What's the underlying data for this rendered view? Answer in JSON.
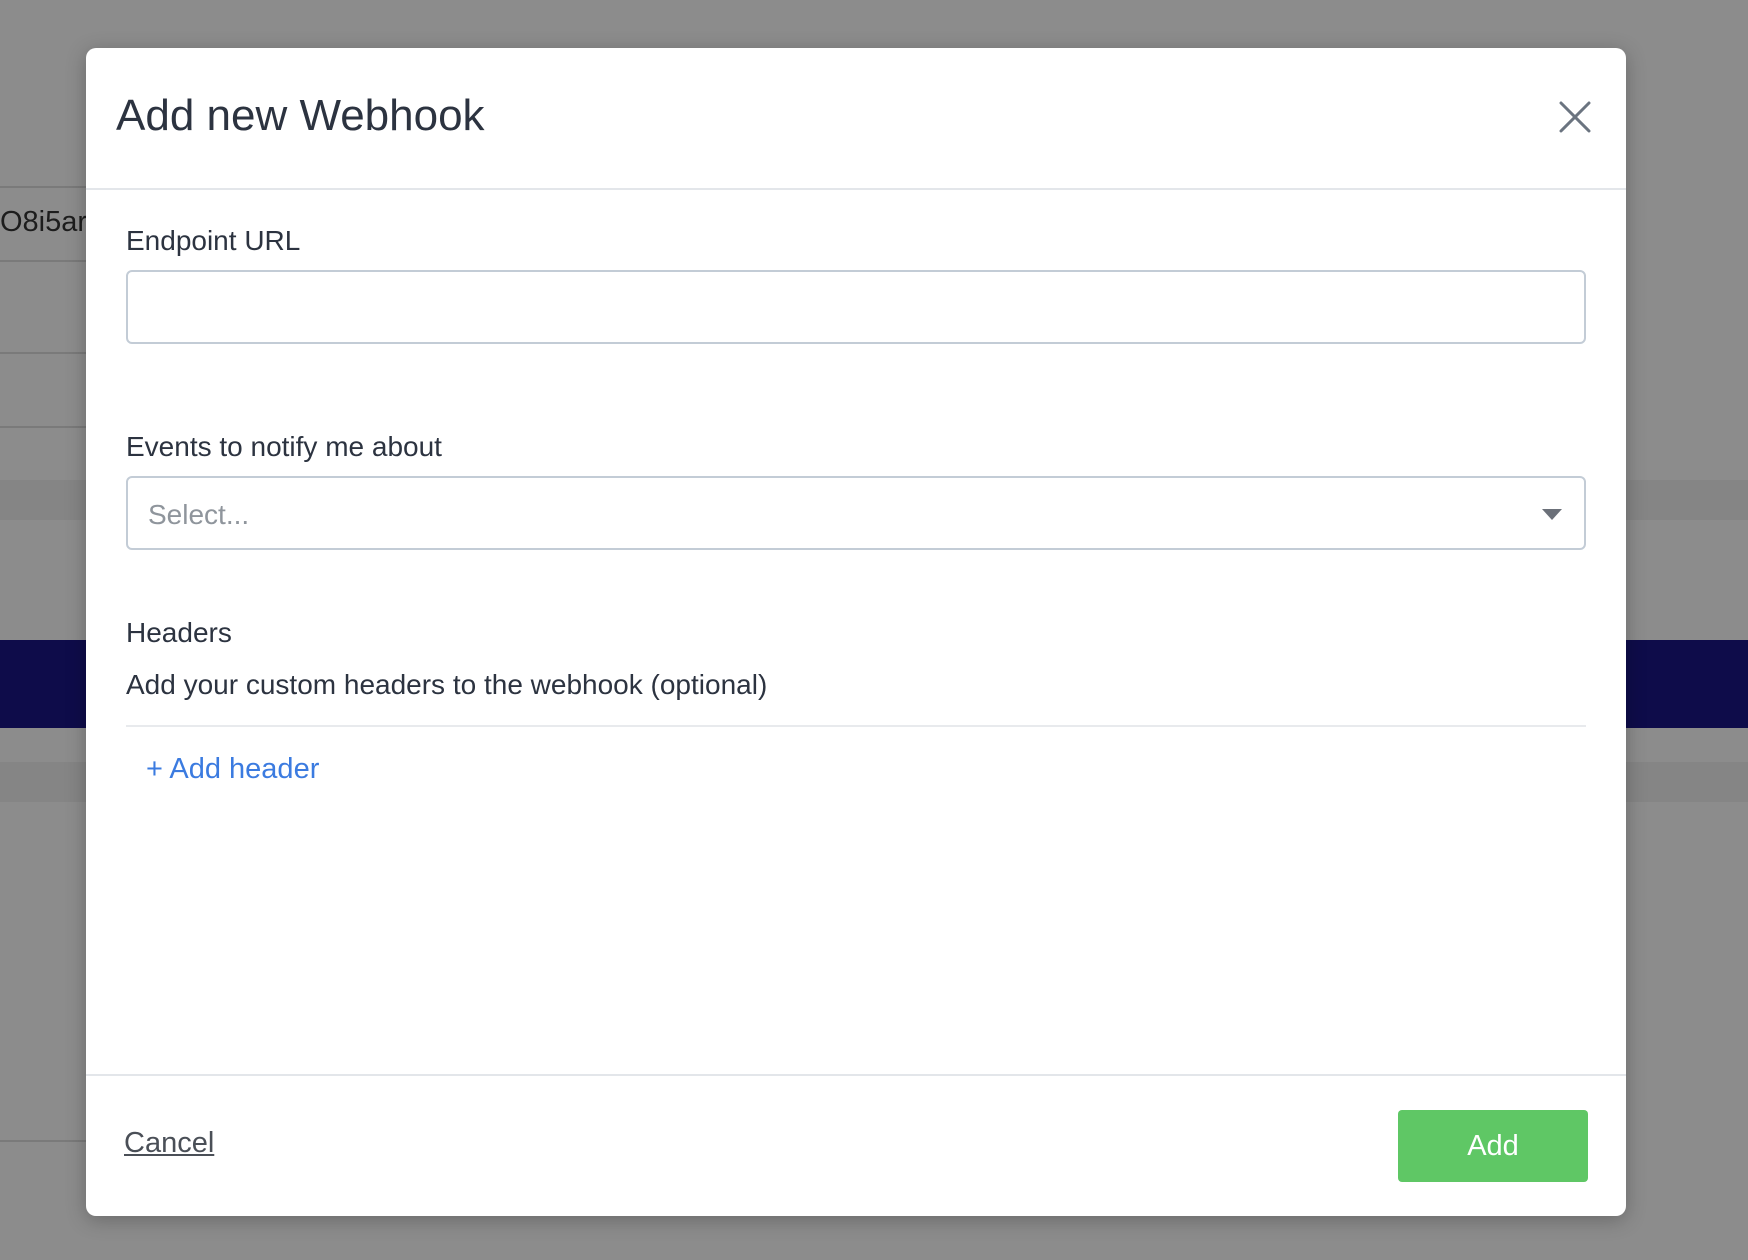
{
  "background": {
    "partial_text": "O8i5ar"
  },
  "modal": {
    "title": "Add new Webhook",
    "close_icon": "close-icon"
  },
  "endpoint": {
    "label": "Endpoint URL",
    "value": "",
    "placeholder": ""
  },
  "events": {
    "label": "Events to notify me about",
    "placeholder": "Select...",
    "caret_icon": "caret-down-icon"
  },
  "headers": {
    "title": "Headers",
    "description": "Add your custom headers to the webhook (optional)",
    "add_link": "+ Add header"
  },
  "footer": {
    "cancel_label": "Cancel",
    "add_label": "Add"
  },
  "colors": {
    "primary_button": "#5fc765",
    "link": "#3b7be0",
    "background_band": "#0e0c4a"
  }
}
